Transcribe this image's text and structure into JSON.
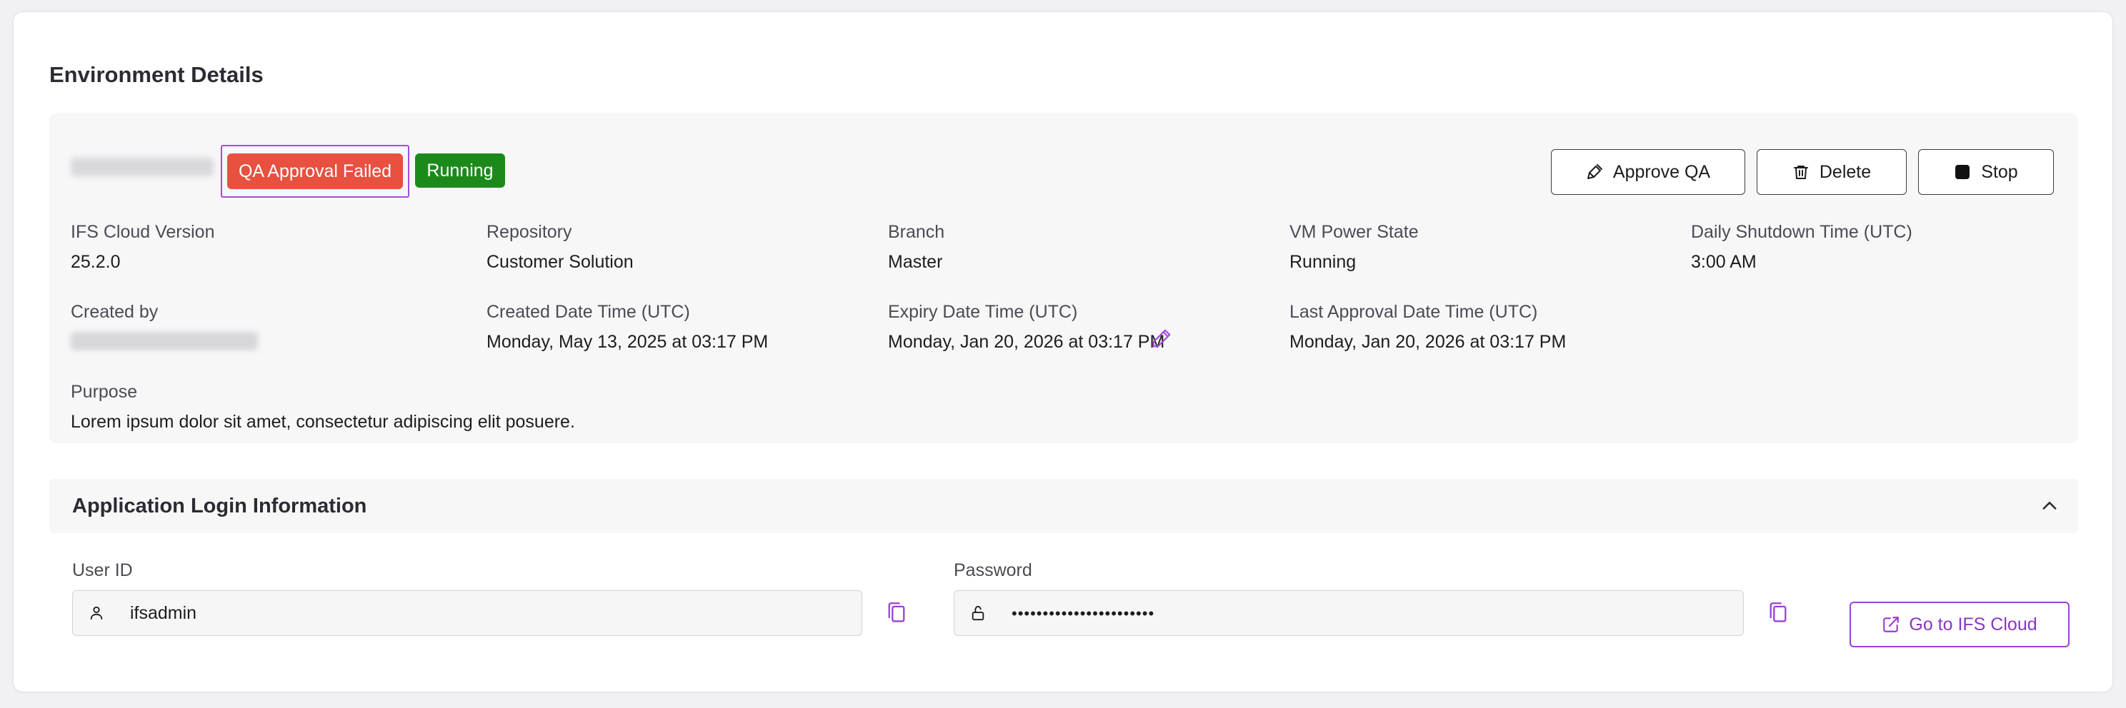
{
  "title": "Environment Details",
  "badges": {
    "qa_status": "QA Approval Failed",
    "run_status": "Running"
  },
  "actions": {
    "approve": "Approve QA",
    "delete": "Delete",
    "stop": "Stop"
  },
  "fields": [
    {
      "label": "IFS Cloud Version",
      "value": "25.2.0"
    },
    {
      "label": "Repository",
      "value": "Customer Solution"
    },
    {
      "label": "Branch",
      "value": "Master"
    },
    {
      "label": "VM Power State",
      "value": "Running"
    },
    {
      "label": "Daily Shutdown Time (UTC)",
      "value": "3:00 AM"
    },
    {
      "label": "Created by",
      "value": ""
    },
    {
      "label": "Created Date Time (UTC)",
      "value": "Monday, May 13, 2025 at 03:17 PM"
    },
    {
      "label": "Expiry Date Time (UTC)",
      "value": "Monday, Jan 20, 2026 at 03:17 PM"
    },
    {
      "label": "Last Approval Date Time (UTC)",
      "value": "Monday, Jan 20, 2026 at 03:17 PM"
    },
    {
      "label": "Purpose",
      "value": "Lorem ipsum dolor sit amet, consectetur adipiscing elit posuere."
    }
  ],
  "login": {
    "title": "Application Login Information",
    "user_label": "User ID",
    "user_value": "ifsadmin",
    "password_label": "Password",
    "password_value": "•••••••••••••••••••••••",
    "go_label": "Go to IFS Cloud"
  },
  "colors": {
    "qa_failed": "#e8503f",
    "running": "#1b8a1b",
    "accent": "#9a3fd6"
  },
  "icons": [
    "brush-icon",
    "trash-icon",
    "stop-square-icon",
    "pencil-icon",
    "chevron-up-icon",
    "user-icon",
    "lock-icon",
    "copy-icon",
    "external-link-icon"
  ]
}
